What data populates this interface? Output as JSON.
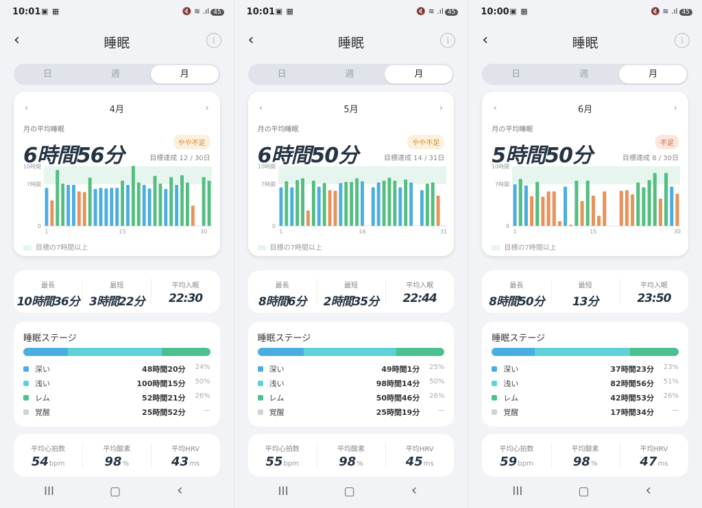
{
  "status_icons": {
    "mid": "▣ ▦",
    "right": "🔇 ≋ .ıl"
  },
  "nav_glyphs": {
    "back": "‹",
    "info": "i",
    "prev": "‹",
    "next": "›"
  },
  "navbar_glyphs": {
    "recent": "III",
    "home": "▢",
    "back": "‹"
  },
  "colors": {
    "deep": "#4aaee2",
    "light": "#5dd3d8",
    "rem": "#4cc18f",
    "awake": "#cfd3d8",
    "orange": "#e8925a",
    "green": "#52be80",
    "goal_band": "#e6f5ee",
    "badge_warn_bg": "#fdf0dc",
    "badge_warn_fg": "#d08a2e",
    "badge_bad_bg": "#fde5dc",
    "badge_bad_fg": "#d0653a"
  },
  "legend_text": "目標の7時間以上",
  "stage_labels": {
    "deep": "深い",
    "light": "浅い",
    "rem": "レム",
    "awake": "覚醒"
  },
  "stats_labels": {
    "longest": "最長",
    "shortest": "最短",
    "avg_bedtime": "平均入眠"
  },
  "vital_labels": {
    "hr": "平均心拍数",
    "spo2": "平均酸素",
    "hrv": "平均HRV"
  },
  "vital_units": {
    "hr": "bpm",
    "spo2": "%",
    "hrv": "ms"
  },
  "screens": [
    {
      "time": "10:01",
      "battery": "45",
      "title": "睡眠",
      "tabs": [
        "日",
        "週",
        "月"
      ],
      "active_tab": 2,
      "month": "4月",
      "avg_label": "月の平均睡眠",
      "avg_value": "6時間56分",
      "badge": "やや不足",
      "badge_type": "warn",
      "goal_text": "目標達成 12 / 30日",
      "stats": {
        "longest": "10時間36分",
        "shortest": "3時間22分",
        "avg_bedtime": "22:30"
      },
      "stage_title": "睡眠ステージ",
      "stages": {
        "deep": {
          "duration": "48時間20分",
          "pct": "24%",
          "value": 24
        },
        "light": {
          "duration": "100時間15分",
          "pct": "50%",
          "value": 50
        },
        "rem": {
          "duration": "52時間21分",
          "pct": "26%",
          "value": 26
        },
        "awake": {
          "duration": "25時間52分",
          "pct": "—"
        }
      },
      "vitals": {
        "hr": "54",
        "spo2": "98",
        "hrv": "43"
      }
    },
    {
      "time": "10:01",
      "battery": "45",
      "title": "睡眠",
      "tabs": [
        "日",
        "週",
        "月"
      ],
      "active_tab": 2,
      "month": "5月",
      "avg_label": "月の平均睡眠",
      "avg_value": "6時間50分",
      "badge": "やや不足",
      "badge_type": "warn",
      "goal_text": "目標達成 14 / 31日",
      "stats": {
        "longest": "8時間6分",
        "shortest": "2時間35分",
        "avg_bedtime": "22:44"
      },
      "stage_title": "睡眠ステージ",
      "stages": {
        "deep": {
          "duration": "49時間1分",
          "pct": "25%",
          "value": 25
        },
        "light": {
          "duration": "98時間14分",
          "pct": "50%",
          "value": 50
        },
        "rem": {
          "duration": "50時間46分",
          "pct": "26%",
          "value": 26
        },
        "awake": {
          "duration": "25時間19分",
          "pct": "—"
        }
      },
      "vitals": {
        "hr": "55",
        "spo2": "98",
        "hrv": "45"
      }
    },
    {
      "time": "10:00",
      "battery": "45",
      "title": "睡眠",
      "tabs": [
        "日",
        "週",
        "月"
      ],
      "active_tab": 2,
      "month": "6月",
      "avg_label": "月の平均睡眠",
      "avg_value": "5時間50分",
      "badge": "不足",
      "badge_type": "bad",
      "goal_text": "目標達成 8 / 30日",
      "stats": {
        "longest": "8時間50分",
        "shortest": "13分",
        "avg_bedtime": "23:50"
      },
      "stage_title": "睡眠ステージ",
      "stages": {
        "deep": {
          "duration": "37時間23分",
          "pct": "23%",
          "value": 23
        },
        "light": {
          "duration": "82時間56分",
          "pct": "51%",
          "value": 51
        },
        "rem": {
          "duration": "42時間53分",
          "pct": "26%",
          "value": 26
        },
        "awake": {
          "duration": "17時間34分",
          "pct": "—"
        }
      },
      "vitals": {
        "hr": "59",
        "spo2": "98",
        "hrv": "47"
      }
    }
  ],
  "chart_data": [
    {
      "type": "bar",
      "ytick_labels": [
        "10時間",
        "7時間",
        "0"
      ],
      "yticks": [
        10,
        7,
        0
      ],
      "ylim": [
        0,
        10
      ],
      "goal_band": [
        7,
        10
      ],
      "xtick_labels": [
        "1",
        "15",
        "30"
      ],
      "xticks": [
        1,
        15,
        30
      ],
      "x": [
        1,
        2,
        3,
        4,
        5,
        6,
        7,
        8,
        9,
        10,
        11,
        12,
        13,
        14,
        15,
        16,
        17,
        18,
        19,
        20,
        21,
        22,
        23,
        24,
        25,
        26,
        27,
        28,
        29,
        30
      ],
      "values": [
        6.4,
        4.3,
        9.4,
        7.1,
        6.9,
        6.9,
        5.8,
        5.7,
        8.1,
        6.2,
        6.4,
        6.3,
        6.4,
        6.4,
        7.6,
        6.9,
        10.1,
        7.3,
        6.9,
        6.3,
        8.4,
        7.1,
        6.2,
        8.2,
        6.9,
        8.5,
        7.3,
        3.4,
        0,
        8.2,
        7.6
      ],
      "colors": [
        "b",
        "o",
        "g",
        "g",
        "b",
        "b",
        "o",
        "o",
        "g",
        "b",
        "b",
        "b",
        "b",
        "b",
        "g",
        "b",
        "g",
        "g",
        "b",
        "b",
        "g",
        "g",
        "b",
        "g",
        "b",
        "g",
        "g",
        "o",
        "n",
        "g",
        "g"
      ]
    },
    {
      "type": "bar",
      "ytick_labels": [
        "10時間",
        "7時間",
        "0"
      ],
      "yticks": [
        10,
        7,
        0
      ],
      "ylim": [
        0,
        10
      ],
      "goal_band": [
        7,
        10
      ],
      "xtick_labels": [
        "1",
        "16",
        "31"
      ],
      "xticks": [
        1,
        16,
        31
      ],
      "x": [
        1,
        2,
        3,
        4,
        5,
        6,
        7,
        8,
        9,
        10,
        11,
        12,
        13,
        14,
        15,
        16,
        17,
        18,
        19,
        20,
        21,
        22,
        23,
        24,
        25,
        26,
        27,
        28,
        29,
        30,
        31
      ],
      "values": [
        6.5,
        7.5,
        6.5,
        7.7,
        8.0,
        2.6,
        7.6,
        6.6,
        7.2,
        6.0,
        5.9,
        7.2,
        7.4,
        7.4,
        8.0,
        7.5,
        0,
        6.5,
        7.3,
        7.6,
        8.1,
        7.6,
        6.5,
        7.8,
        7.3,
        0,
        6.0,
        7.1,
        7.3,
        5.1,
        0
      ],
      "colors": [
        "b",
        "g",
        "b",
        "g",
        "g",
        "o",
        "g",
        "b",
        "g",
        "o",
        "o",
        "b",
        "g",
        "g",
        "g",
        "b",
        "n",
        "b",
        "b",
        "g",
        "g",
        "g",
        "b",
        "g",
        "b",
        "n",
        "b",
        "g",
        "g",
        "o",
        "n"
      ]
    },
    {
      "type": "bar",
      "ytick_labels": [
        "10時間",
        "7時間",
        "0"
      ],
      "yticks": [
        10,
        7,
        0
      ],
      "ylim": [
        0,
        10
      ],
      "goal_band": [
        7,
        10
      ],
      "xtick_labels": [
        "1",
        "15",
        "30"
      ],
      "xticks": [
        1,
        15,
        30
      ],
      "x": [
        1,
        2,
        3,
        4,
        5,
        6,
        7,
        8,
        9,
        10,
        11,
        12,
        13,
        14,
        15,
        16,
        17,
        18,
        19,
        20,
        21,
        22,
        23,
        24,
        25,
        26,
        27,
        28,
        29,
        30
      ],
      "values": [
        7.0,
        7.9,
        6.8,
        5.0,
        7.4,
        4.9,
        5.8,
        5.8,
        0.8,
        6.6,
        0.2,
        7.6,
        4.2,
        7.6,
        5.1,
        1.7,
        5.8,
        0,
        0,
        5.9,
        6.0,
        5.3,
        7.3,
        6.5,
        7.7,
        8.9,
        4.6,
        8.9,
        6.6,
        5.4
      ],
      "colors": [
        "b",
        "g",
        "b",
        "o",
        "g",
        "o",
        "o",
        "o",
        "o",
        "b",
        "o",
        "g",
        "o",
        "g",
        "o",
        "o",
        "o",
        "n",
        "n",
        "o",
        "o",
        "o",
        "g",
        "g",
        "g",
        "g",
        "o",
        "g",
        "b",
        "o"
      ]
    }
  ]
}
